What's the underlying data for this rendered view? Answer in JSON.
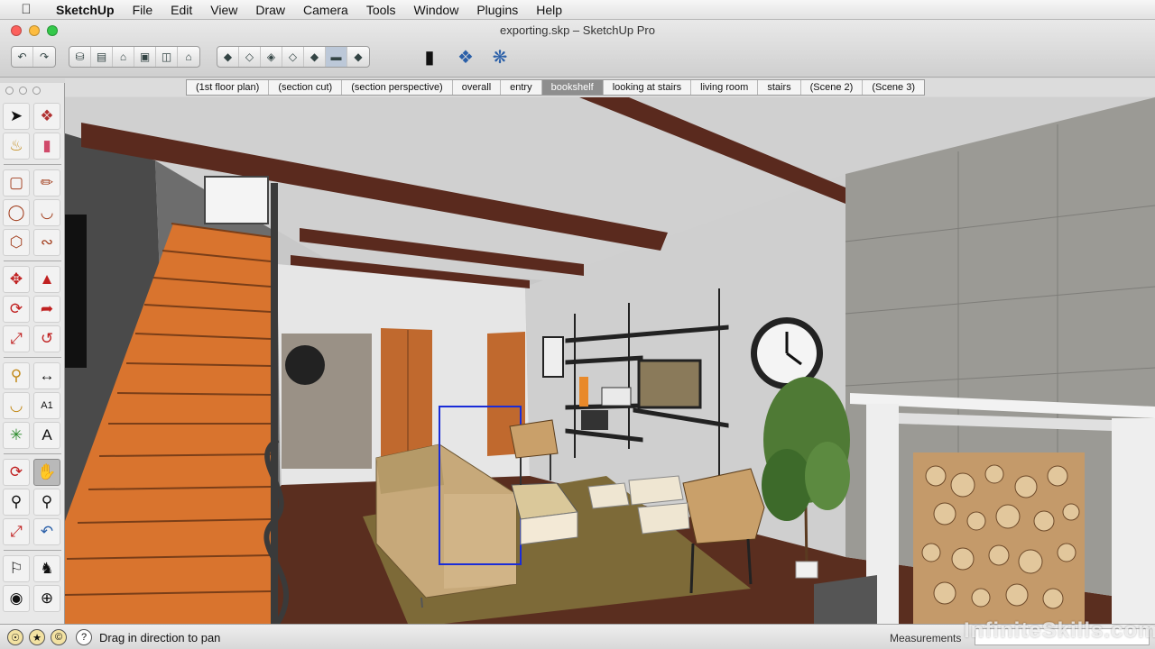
{
  "menubar": {
    "app": "SketchUp",
    "items": [
      "File",
      "Edit",
      "View",
      "Draw",
      "Camera",
      "Tools",
      "Window",
      "Plugins",
      "Help"
    ]
  },
  "window": {
    "title": "exporting.skp – SketchUp Pro"
  },
  "toolbar": {
    "icons": [
      "undo-icon",
      "redo-icon",
      "iso-view-icon",
      "top-view-icon",
      "front-view-icon",
      "right-view-icon",
      "back-view-icon",
      "left-view-icon",
      "xray-style-icon",
      "back-edges-style-icon",
      "wireframe-style-icon",
      "hidden-line-style-icon",
      "shaded-style-icon",
      "shaded-textures-style-icon",
      "monochrome-style-icon",
      "section-plane-icon",
      "components-icon",
      "get-models-icon"
    ]
  },
  "scenes": {
    "tabs": [
      "(1st floor plan)",
      "(section cut)",
      "(section perspective)",
      "overall",
      "entry",
      "bookshelf",
      "looking at stairs",
      "living room",
      "stairs",
      "(Scene 2)",
      "(Scene 3)"
    ],
    "active": "bookshelf"
  },
  "palette": {
    "tools": [
      "select-icon",
      "make-component-icon",
      "paint-bucket-icon",
      "eraser-icon",
      "rectangle-icon",
      "line-icon",
      "circle-icon",
      "arc-icon",
      "polygon-icon",
      "freehand-icon",
      "move-icon",
      "push-pull-icon",
      "rotate-icon",
      "follow-me-icon",
      "scale-icon",
      "offset-icon",
      "tape-measure-icon",
      "dimension-icon",
      "protractor-icon",
      "text-icon",
      "axes-icon",
      "3d-text-icon",
      "orbit-icon",
      "pan-icon",
      "zoom-icon",
      "zoom-window-icon",
      "zoom-extents-icon",
      "previous-view-icon",
      "position-camera-icon",
      "walk-icon",
      "look-around-icon",
      "section-plane-icon"
    ],
    "active": "pan-icon"
  },
  "status": {
    "text": "Drag in direction to pan",
    "measurements_label": "Measurements",
    "measurements_value": ""
  },
  "watermark": "InfiniteSkills.com",
  "colors": {
    "accent": "#8e8e8e",
    "stair_orange": "#d9742e",
    "wood_floor": "#5a2e1f",
    "beam": "#5a2a1e"
  }
}
